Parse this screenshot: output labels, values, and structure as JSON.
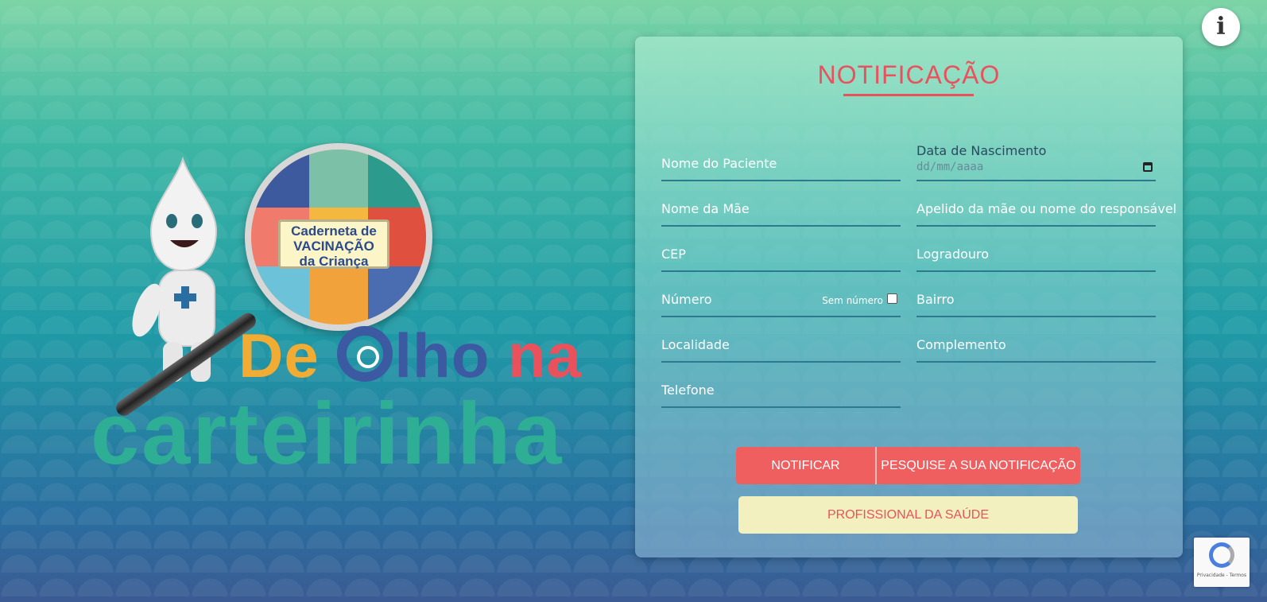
{
  "hero": {
    "lens_label_line1": "Caderneta de",
    "lens_label_line2": "VACINAÇÃO",
    "lens_label_line3": "da Criança",
    "logo_de": "De",
    "logo_olho": "lho",
    "logo_na": "na",
    "logo_carteirinha": "carteirinha"
  },
  "info_button": {
    "icon": "info-icon",
    "glyph": "i"
  },
  "form": {
    "title": "NOTIFICAÇÃO",
    "fields": {
      "nome_paciente": "Nome do Paciente",
      "data_nascimento_label": "Data de Nascimento",
      "data_nascimento_placeholder": "dd/mm/aaaa",
      "nome_mae": "Nome da Mãe",
      "apelido_mae": "Apelido da mãe ou nome do responsável",
      "cep": "CEP",
      "logradouro": "Logradouro",
      "numero": "Número",
      "sem_numero": "Sem número",
      "bairro": "Bairro",
      "localidade": "Localidade",
      "complemento": "Complemento",
      "telefone": "Telefone"
    },
    "buttons": {
      "notificar": "NOTIFICAR",
      "pesquise": "PESQUISE A SUA NOTIFICAÇÃO",
      "profissional": "PROFISSIONAL DA SAÚDE"
    }
  },
  "recaptcha": {
    "text": "Privacidade - Termos"
  },
  "colors": {
    "accent": "#e9525c",
    "button": "#f05f60",
    "secondary_button": "#f3f0c0",
    "logo_green": "#2eae95",
    "logo_blue": "#3b5aa2",
    "logo_orange": "#f2ac33"
  }
}
